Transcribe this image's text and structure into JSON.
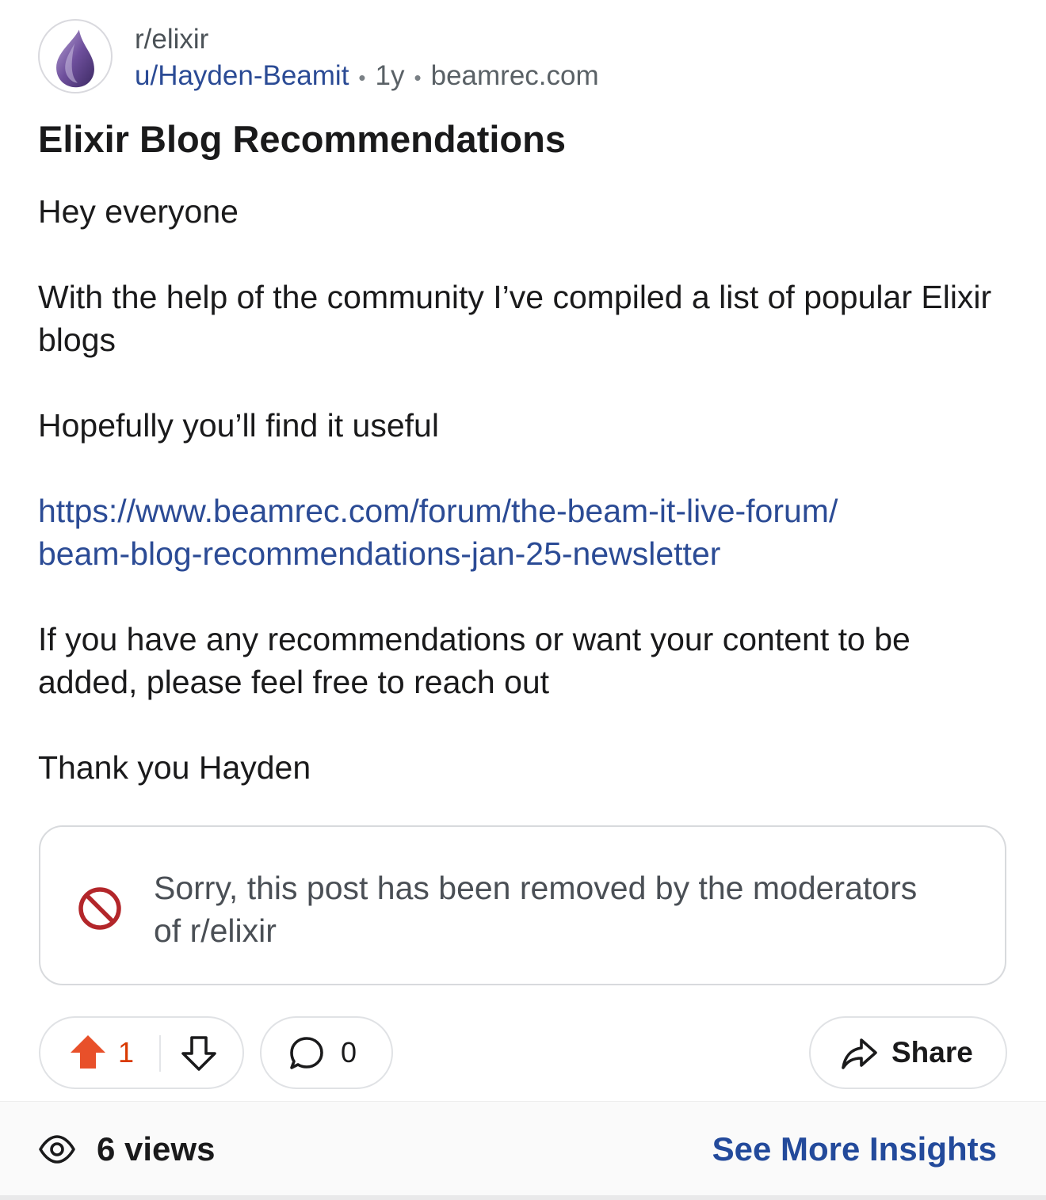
{
  "header": {
    "subreddit": "r/elixir",
    "author": "u/Hayden-Beamit",
    "separator": "•",
    "age": "1y",
    "domain": "beamrec.com",
    "avatar_icon": "elixir-drop-icon"
  },
  "post": {
    "title": "Elixir Blog Recommendations",
    "body": {
      "greeting": "Hey everyone",
      "intro": "With the help of the community I’ve compiled a list of popular Elixir blogs",
      "hope": "Hopefully you’ll find it useful",
      "link_line1": "https://www.beamrec.com/forum/the-beam-it-live-forum/",
      "link_line2": "beam-blog-recommendations-jan-25-newsletter",
      "request": "If you have any recommendations or want your content to be added, please feel free to reach out",
      "signoff": "Thank you Hayden"
    }
  },
  "removed_notice": {
    "icon": "prohibited-icon",
    "text": "Sorry, this post has been removed by the moderators of r/elixir"
  },
  "actions": {
    "upvote_count": "1",
    "comment_count": "0",
    "share_label": "Share"
  },
  "footer": {
    "views": "6 views",
    "insights_label": "See More Insights"
  },
  "colors": {
    "link": "#2b4b95",
    "upvote": "#d93a00",
    "removed_icon": "#b3262a",
    "insights": "#234a9b"
  }
}
